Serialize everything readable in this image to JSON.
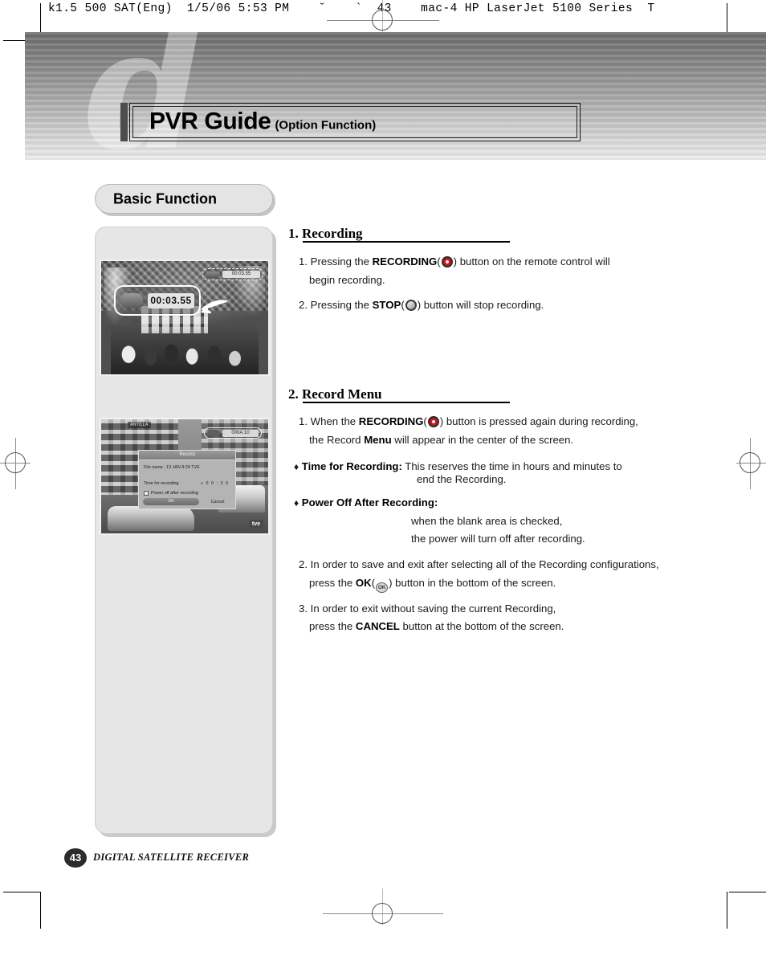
{
  "print_slug": "k1.5 500 SAT(Eng)  1/5/06 5:53 PM    ˘    `  43    mac-4 HP LaserJet 5100 Series  T",
  "banner": {
    "title_main": "PVR Guide",
    "title_sub": "(Option Function)",
    "watermark_glyph": "d"
  },
  "section": {
    "pill_label": "Basic Function"
  },
  "figures": {
    "recording_shot": {
      "osd_small": {
        "time": "00:03.55"
      },
      "osd_zoom": {
        "time": "00:03.55"
      }
    },
    "menu_shot": {
      "osd_small": {
        "time": "000A:10"
      },
      "channel_tag": "ANTILLA",
      "logo_tag": "tve",
      "dialog": {
        "title": "Record",
        "file_name_label": "File name : 13 JAN 9:24 TVE",
        "time_label": "Time for recording",
        "time_value": "+ 0 0 : 3 0",
        "checkbox_label": "Power off after recording",
        "ok_label": "OK",
        "cancel_label": "Cancel"
      }
    }
  },
  "sections": [
    {
      "heading": "1. Recording",
      "items": [
        {
          "number": "1.",
          "lines": [
            [
              {
                "t": "Pressing the "
              },
              {
                "t": "RECORDING",
                "b": true
              },
              {
                "t": "("
              },
              {
                "icon": "record-button-icon"
              },
              {
                "t": ") button on the remote control will"
              }
            ],
            [
              {
                "t": "begin recording."
              }
            ]
          ]
        },
        {
          "number": "2.",
          "lines": [
            [
              {
                "t": "Pressing the "
              },
              {
                "t": "STOP",
                "b": true
              },
              {
                "t": "("
              },
              {
                "icon": "stop-button-icon"
              },
              {
                "t": ") button will stop recording."
              }
            ]
          ]
        }
      ]
    },
    {
      "heading": "2. Record Menu",
      "items": [
        {
          "number": "1.",
          "lines": [
            [
              {
                "t": "When the "
              },
              {
                "t": "RECORDING",
                "b": true
              },
              {
                "t": "("
              },
              {
                "icon": "record-button-icon"
              },
              {
                "t": ") button is pressed again during recording,"
              }
            ],
            [
              {
                "t": "the Record "
              },
              {
                "t": "Menu",
                "b": true
              },
              {
                "t": " will appear in the center of the screen."
              }
            ]
          ]
        },
        {
          "number": "♦",
          "lines": [
            [
              {
                "t": "Time for Recording:",
                "b": true
              },
              {
                "t": " This reserves the time in hours and minutes to"
              }
            ],
            [
              {
                "t": "end the Recording.",
                "indent": 186
              }
            ]
          ]
        },
        {
          "number": "♦",
          "lines": [
            [
              {
                "t": "Power Off After Recording:",
                "b": true
              }
            ],
            [
              {
                "t": "when the blank area is checked,",
                "indent": 155
              }
            ],
            [
              {
                "t": "the power will turn off after recording.",
                "indent": 155
              }
            ]
          ]
        },
        {
          "number": "2.",
          "lines": [
            [
              {
                "t": "In order to save and exit after selecting all of the Recording configurations,"
              }
            ],
            [
              {
                "t": "press the "
              },
              {
                "t": "OK",
                "b": true
              },
              {
                "t": "("
              },
              {
                "icon": "ok-button-icon"
              },
              {
                "t": ") button in the bottom of the screen."
              }
            ]
          ]
        },
        {
          "number": "3.",
          "lines": [
            [
              {
                "t": "In order to exit without saving the current Recording,"
              }
            ],
            [
              {
                "t": "press the "
              },
              {
                "t": "CANCEL",
                "b": true
              },
              {
                "t": " button at the bottom of the screen."
              }
            ]
          ]
        }
      ]
    }
  ],
  "text_blocks": {
    "s1_head": "1. Recording",
    "s1_i1_l1_a": "Pressing the ",
    "s1_i1_l1_b": "RECORDING",
    "s1_i1_l1_c": ") button on the remote control will",
    "s1_i1_l2": "begin recording.",
    "s1_i2_a": "Pressing the ",
    "s1_i2_b": "STOP",
    "s1_i2_c": ") button will stop recording.",
    "s2_head": "2. Record Menu",
    "s2_i1_l1_a": "When the ",
    "s2_i1_l1_b": "RECORDING",
    "s2_i1_l1_c": ") button is pressed again during recording,",
    "s2_i1_l2_a": "the Record ",
    "s2_i1_l2_b": "Menu",
    "s2_i1_l2_c": " will appear in the center of the screen.",
    "s2_b1_label": "Time for Recording:",
    "s2_b1_rest": " This reserves the time in hours and minutes to",
    "s2_b1_l2": "end the Recording.",
    "s2_b2_label": "Power Off After Recording:",
    "s2_b2_l2": "when the blank area is checked,",
    "s2_b2_l3": "the power will turn off after recording.",
    "s2_i2_l1": "In order to save and exit after selecting all of the Recording configurations,",
    "s2_i2_l2_a": "press the ",
    "s2_i2_l2_b": "OK",
    "s2_i2_l2_c": ") button in the bottom of the screen.",
    "s2_i3_l1": "In order to exit without saving the current Recording,",
    "s2_i3_l2_a": "press the ",
    "s2_i3_l2_b": "CANCEL",
    "s2_i3_l2_c": " button at the bottom of the screen.",
    "num_1": "1.",
    "num_2": "2.",
    "num_3": "3.",
    "diamond": "♦",
    "paren_open": "(",
    "ok_icon_text": "OK"
  },
  "footer": {
    "page_number": "43",
    "label": "DIGITAL SATELLITE RECEIVER"
  },
  "colors": {
    "record_red": "#c8161d",
    "banner_dark": "#6f6f6f",
    "banner_light": "#ededed",
    "panel_gray": "#e6e6e6",
    "pill_gray": "#e4e4e4"
  }
}
